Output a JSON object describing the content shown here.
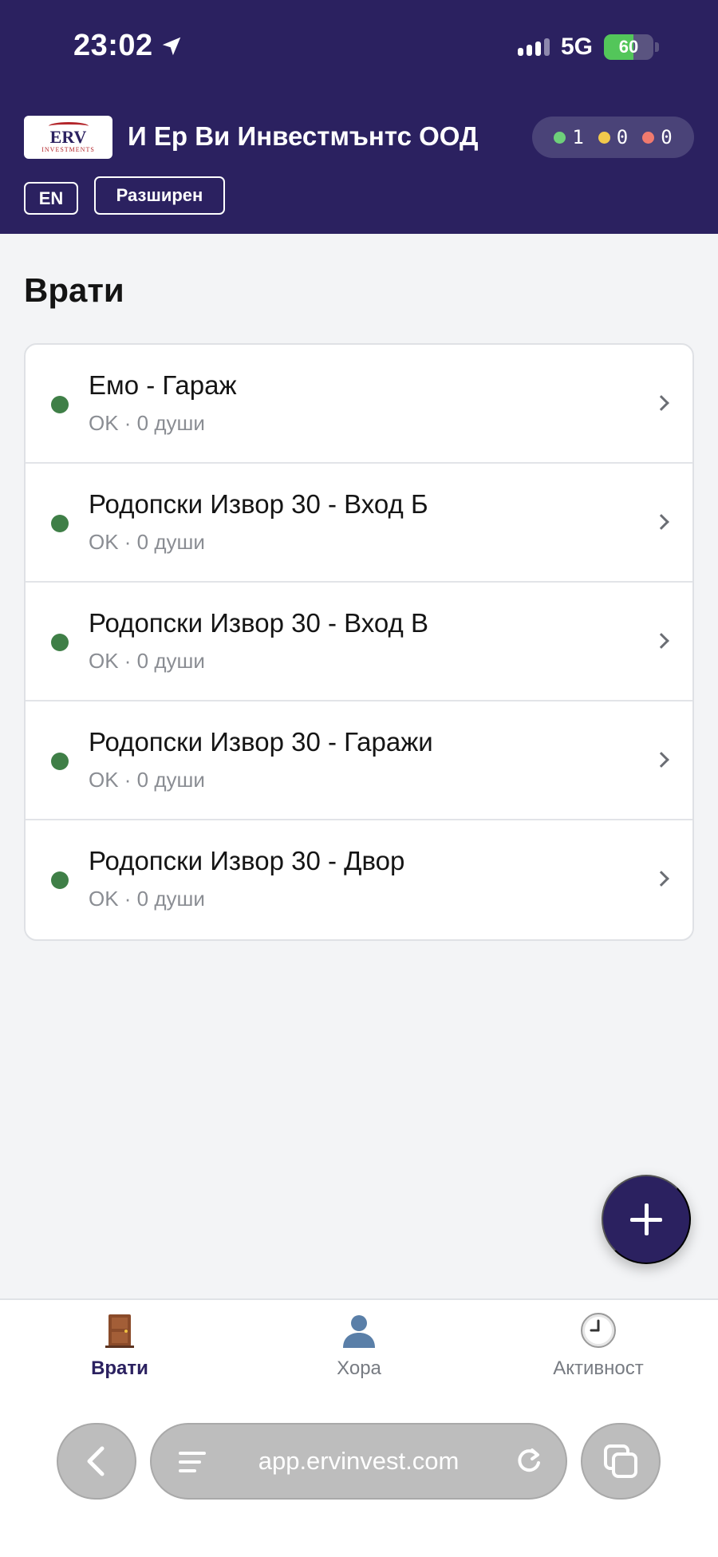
{
  "status_bar": {
    "time": "23:02",
    "network": "5G",
    "battery": "60",
    "battery_level": 0.6
  },
  "header": {
    "logo_text": "ERV",
    "logo_subtext": "INVESTMENTS",
    "company_name": "И Ер Ви Инвестмънтс ООД",
    "counters": [
      {
        "value": "1",
        "color": "#6ed07a"
      },
      {
        "value": "0",
        "color": "#f2c94c"
      },
      {
        "value": "0",
        "color": "#f07a6e"
      }
    ],
    "lang_button": "EN",
    "mode_button": "Разширен"
  },
  "main": {
    "title": "Врати",
    "doors": [
      {
        "name": "Емо - Гараж",
        "status": "OK · 0 души",
        "status_color": "#3f7f47"
      },
      {
        "name": "Родопски Извор 30 - Вход Б",
        "status": "OK · 0 души",
        "status_color": "#3f7f47"
      },
      {
        "name": "Родопски Извор 30 - Вход В",
        "status": "OK · 0 души",
        "status_color": "#3f7f47"
      },
      {
        "name": "Родопски Извор 30 - Гаражи",
        "status": "OK · 0 души",
        "status_color": "#3f7f47"
      },
      {
        "name": "Родопски Извор 30 - Двор",
        "status": "OK · 0 души",
        "status_color": "#3f7f47"
      }
    ]
  },
  "bottom_nav": {
    "items": [
      {
        "label": "Врати",
        "icon": "door-icon",
        "active": true
      },
      {
        "label": "Хора",
        "icon": "person-icon",
        "active": false
      },
      {
        "label": "Активност",
        "icon": "clock-icon",
        "active": false
      }
    ]
  },
  "browser": {
    "url": "app.ervinvest.com"
  },
  "colors": {
    "brand": "#2b2160",
    "ok_status": "#3f7f47"
  }
}
